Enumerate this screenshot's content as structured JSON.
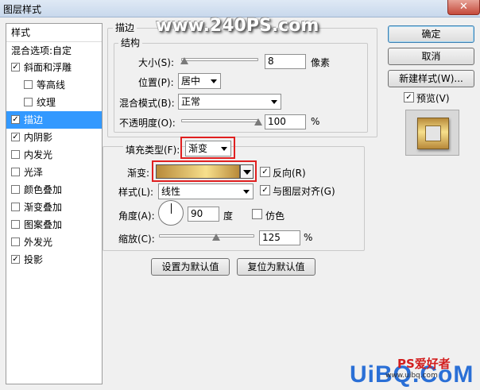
{
  "window": {
    "title": "图层样式",
    "close_glyph": "✕"
  },
  "style_list": {
    "header": "样式",
    "blend_options": "混合选项:自定",
    "items": [
      {
        "label": "斜面和浮雕",
        "checked": true,
        "indent": false,
        "selected": false
      },
      {
        "label": "等高线",
        "checked": false,
        "indent": true,
        "selected": false
      },
      {
        "label": "纹理",
        "checked": false,
        "indent": true,
        "selected": false
      },
      {
        "label": "描边",
        "checked": true,
        "indent": false,
        "selected": true
      },
      {
        "label": "内阴影",
        "checked": true,
        "indent": false,
        "selected": false
      },
      {
        "label": "内发光",
        "checked": false,
        "indent": false,
        "selected": false
      },
      {
        "label": "光泽",
        "checked": false,
        "indent": false,
        "selected": false
      },
      {
        "label": "颜色叠加",
        "checked": false,
        "indent": false,
        "selected": false
      },
      {
        "label": "渐变叠加",
        "checked": false,
        "indent": false,
        "selected": false
      },
      {
        "label": "图案叠加",
        "checked": false,
        "indent": false,
        "selected": false
      },
      {
        "label": "外发光",
        "checked": false,
        "indent": false,
        "selected": false
      },
      {
        "label": "投影",
        "checked": true,
        "indent": false,
        "selected": false
      }
    ],
    "check_glyph": "✓"
  },
  "stroke": {
    "legend": "描边",
    "structure": {
      "legend": "结构",
      "size_label": "大小(S):",
      "size_value": "8",
      "size_unit": "像素",
      "position_label": "位置(P):",
      "position_value": "居中",
      "blend_label": "混合模式(B):",
      "blend_value": "正常",
      "opacity_label": "不透明度(O):",
      "opacity_value": "100",
      "opacity_unit": "%",
      "size_slider_fraction": 0.04,
      "opacity_slider_fraction": 1.0
    },
    "fill": {
      "type_label": "填充类型(F):",
      "type_value": "渐变",
      "gradient_label": "渐变:",
      "reverse_label": "反向(R)",
      "reverse_checked": true,
      "style_label": "样式(L):",
      "style_value": "线性",
      "align_label": "与图层对齐(G)",
      "align_checked": true,
      "angle_label": "角度(A):",
      "angle_value": "90",
      "angle_unit": "度",
      "dither_label": "仿色",
      "dither_checked": false,
      "scale_label": "缩放(C):",
      "scale_value": "125",
      "scale_unit": "%",
      "scale_slider_fraction": 0.6
    },
    "set_default": "设置为默认值",
    "reset_default": "复位为默认值"
  },
  "buttons": {
    "ok": "确定",
    "cancel": "取消",
    "new_style": "新建样式(W)..."
  },
  "preview": {
    "label": "预览(V)",
    "checked": true
  },
  "colors": {
    "selection": "#3399ff",
    "highlight_box": "#e02020",
    "gradient_light": "#f7e08c",
    "gradient_dark": "#b88a3a"
  },
  "watermarks": {
    "top": "www.240PS.com",
    "bottom_logo": "UiBQ.CoM",
    "bottom_small": "www.uibq.com",
    "bottom_cn": "PS爱好者"
  }
}
